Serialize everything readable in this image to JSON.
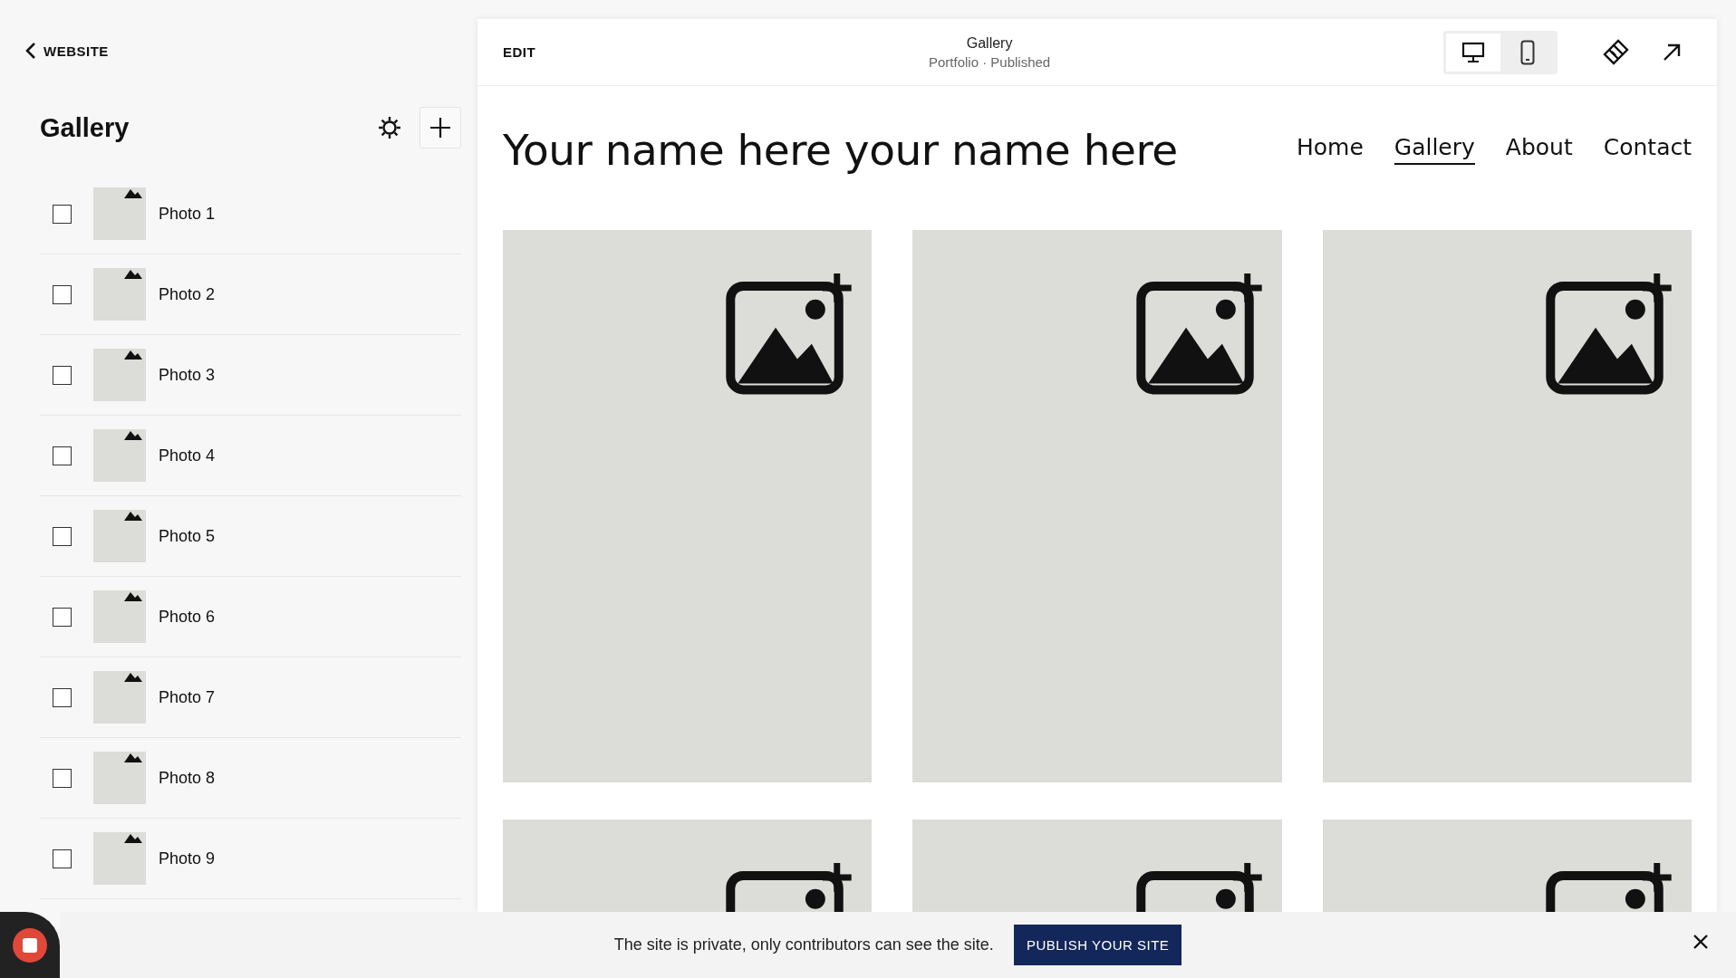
{
  "sidebar": {
    "back_link": "WEBSITE",
    "title": "Gallery",
    "items": [
      {
        "label": "Photo 1",
        "checked": false
      },
      {
        "label": "Photo 2",
        "checked": false
      },
      {
        "label": "Photo 3",
        "checked": false
      },
      {
        "label": "Photo 4",
        "checked": false
      },
      {
        "label": "Photo 5",
        "checked": false
      },
      {
        "label": "Photo 6",
        "checked": false
      },
      {
        "label": "Photo 7",
        "checked": false
      },
      {
        "label": "Photo 8",
        "checked": false
      },
      {
        "label": "Photo 9",
        "checked": false
      }
    ]
  },
  "toolbar": {
    "mode": "EDIT",
    "page_title": "Gallery",
    "page_subtitle": "Portfolio · Published",
    "views": [
      {
        "kind": "desktop",
        "selected": true
      },
      {
        "kind": "mobile",
        "selected": false
      }
    ]
  },
  "site": {
    "name": "Your name here your name here",
    "nav": [
      {
        "label": "Home",
        "selected": false
      },
      {
        "label": "Gallery",
        "selected": true
      },
      {
        "label": "About",
        "selected": false
      },
      {
        "label": "Contact",
        "selected": false
      }
    ]
  },
  "banner": {
    "message": "The site is private, only contributors can see the site.",
    "button": "PUBLISH YOUR SITE"
  }
}
